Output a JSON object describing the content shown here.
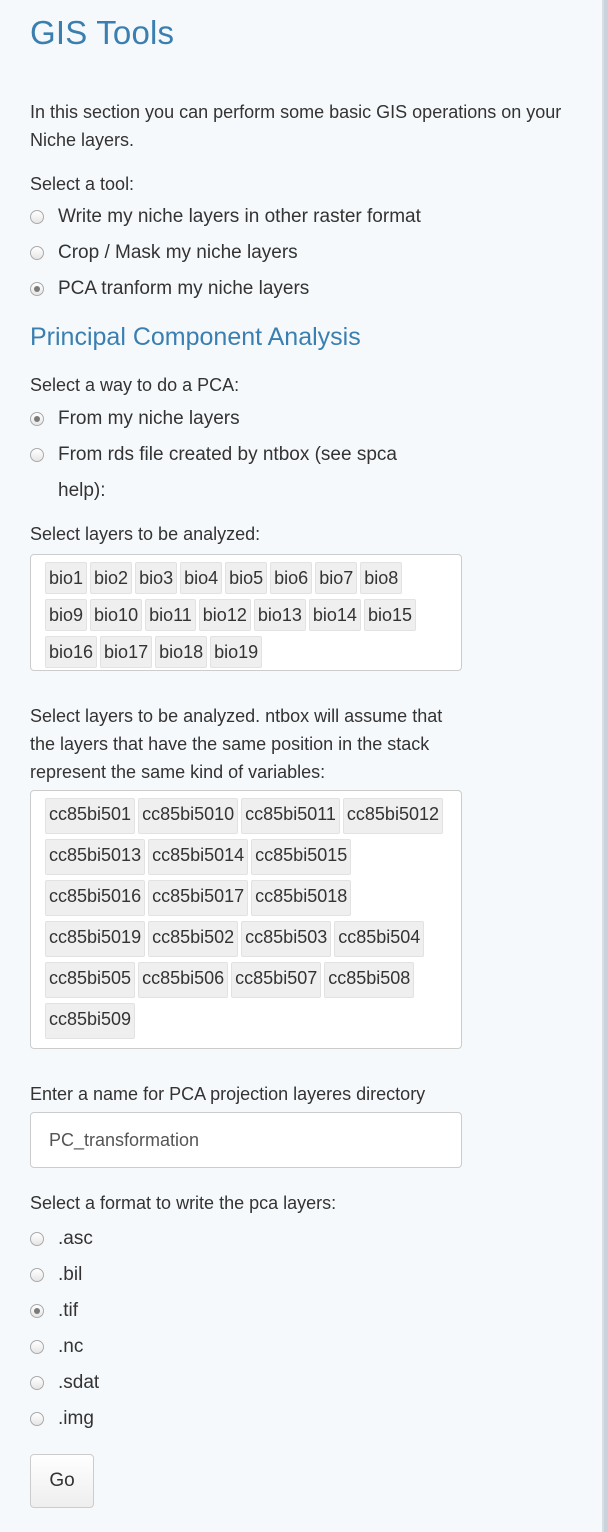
{
  "title": "GIS Tools",
  "intro": "In this section you can perform some basic GIS operations on your Niche layers.",
  "tool_prompt": "Select a tool:",
  "tools": [
    {
      "label": "Write my niche layers in other raster format",
      "selected": false
    },
    {
      "label": "Crop / Mask my niche layers",
      "selected": false
    },
    {
      "label": "PCA tranform my niche layers",
      "selected": true
    }
  ],
  "pca_heading": "Principal Component Analysis",
  "pca_prompt": "Select a way to do a PCA:",
  "pca_options": [
    {
      "label": "From my niche layers",
      "selected": true
    },
    {
      "label": "From rds file created by ntbox (see spca help):",
      "selected": false
    }
  ],
  "layers_prompt": "Select layers to be analyzed:",
  "layers": [
    "bio1",
    "bio2",
    "bio3",
    "bio4",
    "bio5",
    "bio6",
    "bio7",
    "bio8",
    "bio9",
    "bio10",
    "bio11",
    "bio12",
    "bio13",
    "bio14",
    "bio15",
    "bio16",
    "bio17",
    "bio18",
    "bio19"
  ],
  "proj_layers_prompt": "Select layers to be analyzed. ntbox will assume that the layers that have the same position in the stack represent the same kind of variables:",
  "proj_layers": [
    "cc85bi501",
    "cc85bi5010",
    "cc85bi5011",
    "cc85bi5012",
    "cc85bi5013",
    "cc85bi5014",
    "cc85bi5015",
    "cc85bi5016",
    "cc85bi5017",
    "cc85bi5018",
    "cc85bi5019",
    "cc85bi502",
    "cc85bi503",
    "cc85bi504",
    "cc85bi505",
    "cc85bi506",
    "cc85bi507",
    "cc85bi508",
    "cc85bi509"
  ],
  "dir_prompt": "Enter a name for PCA projection layeres directory",
  "dir_value": "PC_transformation",
  "format_prompt": "Select a format to write the pca layers:",
  "formats": [
    {
      "label": ".asc",
      "selected": false
    },
    {
      "label": ".bil",
      "selected": false
    },
    {
      "label": ".tif",
      "selected": true
    },
    {
      "label": ".nc",
      "selected": false
    },
    {
      "label": ".sdat",
      "selected": false
    },
    {
      "label": ".img",
      "selected": false
    }
  ],
  "go_label": "Go"
}
